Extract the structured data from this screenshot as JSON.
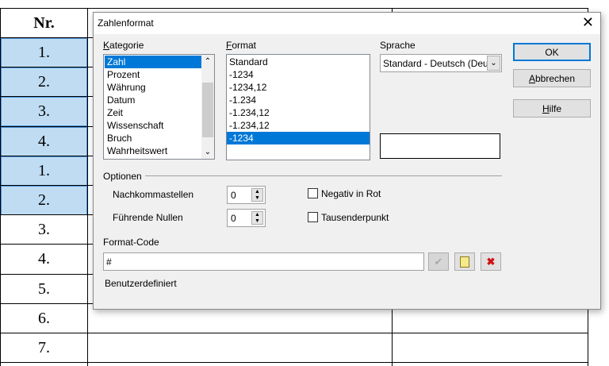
{
  "table": {
    "header": "Nr.",
    "rows": [
      "1.",
      "2.",
      "3.",
      "4.",
      "1.",
      "2.",
      "3.",
      "4.",
      "5.",
      "6.",
      "7."
    ],
    "selected_count": 6,
    "selection_color": "#bfdcf3"
  },
  "dialog": {
    "title": "Zahlenformat",
    "kategorie_label": "Kategorie",
    "kategorie_items": [
      "Zahl",
      "Prozent",
      "Währung",
      "Datum",
      "Zeit",
      "Wissenschaft",
      "Bruch",
      "Wahrheitswert"
    ],
    "kategorie_selected": "Zahl",
    "format_label": "Format",
    "format_items": [
      "Standard",
      "-1234",
      "-1234,12",
      "-1.234",
      "-1.234,12",
      "-1.234,12",
      "-1234"
    ],
    "format_selected_index": 6,
    "sprache_label": "Sprache",
    "sprache_value": "Standard - Deutsch (Deut",
    "ok": "OK",
    "cancel": "Abbrechen",
    "help": "Hilfe",
    "optionen_label": "Optionen",
    "nachkomma_label": "Nachkommastellen",
    "nachkomma_value": "0",
    "fuehrende_label": "Führende Nullen",
    "fuehrende_value": "0",
    "negativ_label": "Negativ in Rot",
    "negativ_checked": false,
    "tausender_label": "Tausenderpunkt",
    "tausender_checked": false,
    "formatcode_label": "Format-Code",
    "formatcode_value": "#",
    "description": "Benutzerdefiniert",
    "accent": "#0078d7"
  }
}
